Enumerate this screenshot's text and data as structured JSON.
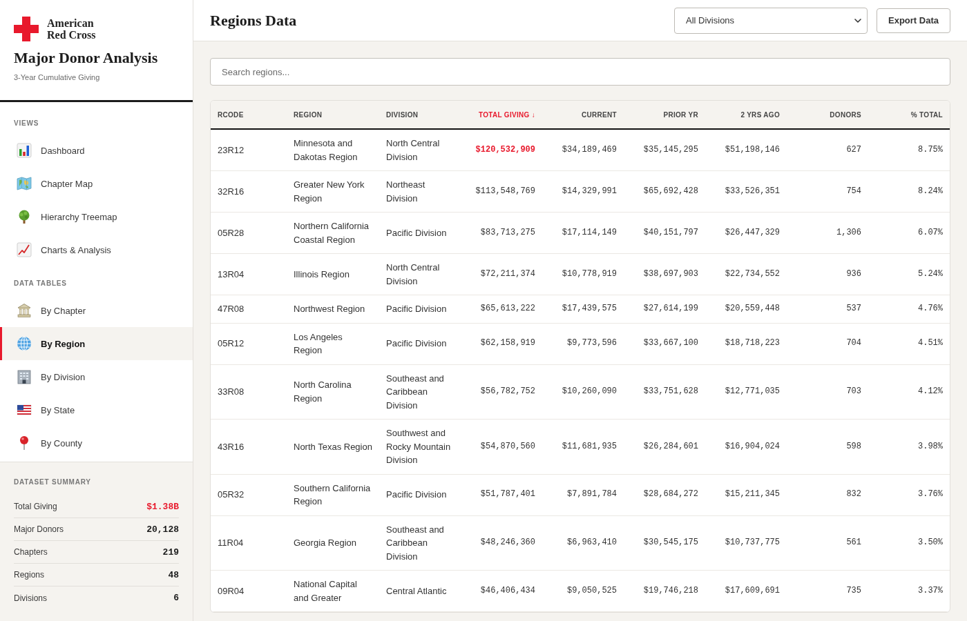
{
  "sidebar": {
    "logo": {
      "text": "American Red Cross"
    },
    "title": "Major Donor Analysis",
    "subtitle": "3-Year Cumulative Giving",
    "sections": [
      {
        "title": "VIEWS",
        "items": [
          {
            "label": "Dashboard",
            "selected": false
          },
          {
            "label": "Chapter Map",
            "selected": false
          },
          {
            "label": "Hierarchy Treemap",
            "selected": false
          },
          {
            "label": "Charts & Analysis",
            "selected": false
          }
        ]
      },
      {
        "title": "DATA TABLES",
        "items": [
          {
            "label": "By Chapter",
            "selected": false
          },
          {
            "label": "By Region",
            "selected": true
          },
          {
            "label": "By Division",
            "selected": false
          },
          {
            "label": "By State",
            "selected": false
          },
          {
            "label": "By County",
            "selected": false
          }
        ]
      }
    ],
    "summary": {
      "title": "DATASET SUMMARY",
      "rows": [
        {
          "label": "Total Giving",
          "value": "$1.38B",
          "highlighted": true
        },
        {
          "label": "Major Donors",
          "value": "20,128",
          "highlighted": false
        },
        {
          "label": "Chapters",
          "value": "219",
          "highlighted": false
        },
        {
          "label": "Regions",
          "value": "48",
          "highlighted": false
        },
        {
          "label": "Divisions",
          "value": "6",
          "highlighted": false
        }
      ]
    }
  },
  "main": {
    "title": "Regions Data",
    "division_select": {
      "value": "All Divisions"
    },
    "export_button": "Export Data",
    "search": {
      "placeholder": "Search regions..."
    },
    "table": {
      "columns": [
        {
          "label": "RCODE",
          "kind": "text",
          "sorted": false
        },
        {
          "label": "REGION",
          "kind": "text",
          "sorted": false
        },
        {
          "label": "DIVISION",
          "kind": "text",
          "sorted": false
        },
        {
          "label": "TOTAL GIVING ↓",
          "kind": "number",
          "sorted": true
        },
        {
          "label": "CURRENT",
          "kind": "number",
          "sorted": false
        },
        {
          "label": "PRIOR YR",
          "kind": "number",
          "sorted": false
        },
        {
          "label": "2 YRS AGO",
          "kind": "number",
          "sorted": false
        },
        {
          "label": "DONORS",
          "kind": "number",
          "sorted": false
        },
        {
          "label": "% TOTAL",
          "kind": "number",
          "sorted": false
        }
      ],
      "rows": [
        {
          "cells": [
            "23R12",
            "Minnesota and Dakotas Region",
            "North Central Division",
            "$120,532,909",
            "$34,189,469",
            "$35,145,295",
            "$51,198,146",
            "627",
            "8.75%"
          ],
          "highlighted": true
        },
        {
          "cells": [
            "32R16",
            "Greater New York Region",
            "Northeast Division",
            "$113,548,769",
            "$14,329,991",
            "$65,692,428",
            "$33,526,351",
            "754",
            "8.24%"
          ],
          "highlighted": false
        },
        {
          "cells": [
            "05R28",
            "Northern California Coastal Region",
            "Pacific Division",
            "$83,713,275",
            "$17,114,149",
            "$40,151,797",
            "$26,447,329",
            "1,306",
            "6.07%"
          ],
          "highlighted": false
        },
        {
          "cells": [
            "13R04",
            "Illinois Region",
            "North Central Division",
            "$72,211,374",
            "$10,778,919",
            "$38,697,903",
            "$22,734,552",
            "936",
            "5.24%"
          ],
          "highlighted": false
        },
        {
          "cells": [
            "47R08",
            "Northwest Region",
            "Pacific Division",
            "$65,613,222",
            "$17,439,575",
            "$27,614,199",
            "$20,559,448",
            "537",
            "4.76%"
          ],
          "highlighted": false
        },
        {
          "cells": [
            "05R12",
            "Los Angeles Region",
            "Pacific Division",
            "$62,158,919",
            "$9,773,596",
            "$33,667,100",
            "$18,718,223",
            "704",
            "4.51%"
          ],
          "highlighted": false
        },
        {
          "cells": [
            "33R08",
            "North Carolina Region",
            "Southeast and Caribbean Division",
            "$56,782,752",
            "$10,260,090",
            "$33,751,628",
            "$12,771,035",
            "703",
            "4.12%"
          ],
          "highlighted": false
        },
        {
          "cells": [
            "43R16",
            "North Texas Region",
            "Southwest and Rocky Mountain Division",
            "$54,870,560",
            "$11,681,935",
            "$26,284,601",
            "$16,904,024",
            "598",
            "3.98%"
          ],
          "highlighted": false
        },
        {
          "cells": [
            "05R32",
            "Southern California Region",
            "Pacific Division",
            "$51,787,401",
            "$7,891,784",
            "$28,684,272",
            "$15,211,345",
            "832",
            "3.76%"
          ],
          "highlighted": false
        },
        {
          "cells": [
            "11R04",
            "Georgia Region",
            "Southeast and Caribbean Division",
            "$48,246,360",
            "$6,963,410",
            "$30,545,175",
            "$10,737,775",
            "561",
            "3.50%"
          ],
          "highlighted": false
        },
        {
          "cells": [
            "09R04",
            "National Capital and Greater",
            "Central Atlantic",
            "$46,406,434",
            "$9,050,525",
            "$19,746,218",
            "$17,609,691",
            "735",
            "3.37%"
          ],
          "highlighted": false
        }
      ]
    }
  }
}
